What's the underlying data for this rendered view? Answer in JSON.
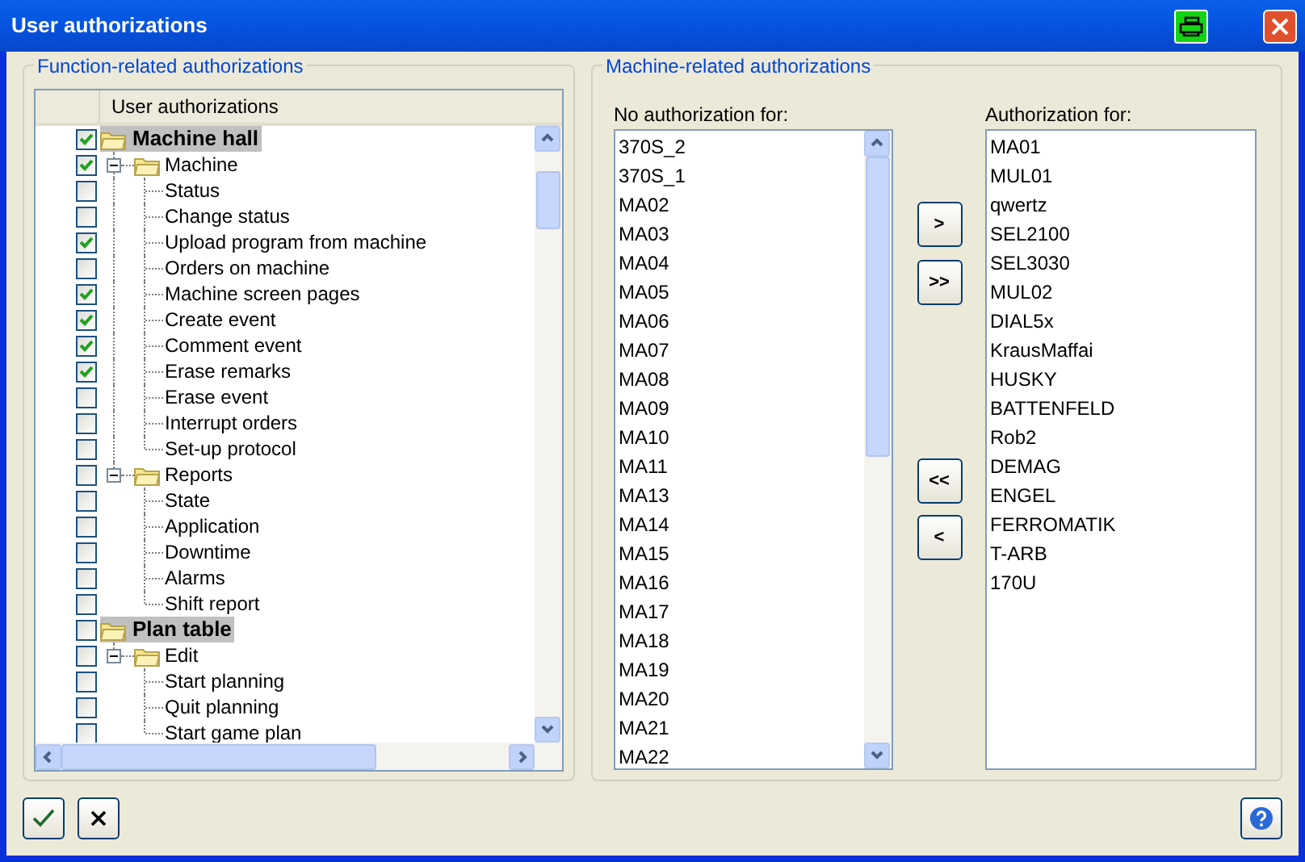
{
  "window": {
    "title": "User authorizations"
  },
  "function_group": {
    "title": "Function-related authorizations",
    "column_header": "User authorizations",
    "tree": [
      {
        "label": "Machine hall",
        "checked": true,
        "kind": "root",
        "children": [
          {
            "label": "Machine",
            "checked": true,
            "kind": "folder",
            "expanded": true,
            "children": [
              {
                "label": "Status",
                "checked": false,
                "kind": "leaf"
              },
              {
                "label": "Change status",
                "checked": false,
                "kind": "leaf"
              },
              {
                "label": "Upload program from machine",
                "checked": true,
                "kind": "leaf"
              },
              {
                "label": "Orders on machine",
                "checked": false,
                "kind": "leaf"
              },
              {
                "label": "Machine screen pages",
                "checked": true,
                "kind": "leaf"
              },
              {
                "label": "Create event",
                "checked": true,
                "kind": "leaf"
              },
              {
                "label": "Comment event",
                "checked": true,
                "kind": "leaf"
              },
              {
                "label": "Erase remarks",
                "checked": true,
                "kind": "leaf"
              },
              {
                "label": "Erase event",
                "checked": false,
                "kind": "leaf"
              },
              {
                "label": "Interrupt orders",
                "checked": false,
                "kind": "leaf"
              },
              {
                "label": "Set-up protocol",
                "checked": false,
                "kind": "leaf"
              }
            ]
          },
          {
            "label": "Reports",
            "checked": false,
            "kind": "folder",
            "expanded": true,
            "children": [
              {
                "label": "State",
                "checked": false,
                "kind": "leaf"
              },
              {
                "label": "Application",
                "checked": false,
                "kind": "leaf"
              },
              {
                "label": "Downtime",
                "checked": false,
                "kind": "leaf"
              },
              {
                "label": "Alarms",
                "checked": false,
                "kind": "leaf"
              },
              {
                "label": "Shift report",
                "checked": false,
                "kind": "leaf"
              }
            ]
          }
        ]
      },
      {
        "label": "Plan table",
        "checked": false,
        "kind": "root",
        "children": [
          {
            "label": "Edit",
            "checked": false,
            "kind": "folder",
            "expanded": true,
            "children": [
              {
                "label": "Start planning",
                "checked": false,
                "kind": "leaf"
              },
              {
                "label": "Quit planning",
                "checked": false,
                "kind": "leaf"
              },
              {
                "label": "Start game plan",
                "checked": false,
                "kind": "leaf"
              }
            ]
          }
        ]
      }
    ]
  },
  "machine_group": {
    "title": "Machine-related authorizations",
    "unauthorized": {
      "label": "No authorization for:",
      "items": [
        "370S_2",
        "370S_1",
        "MA02",
        "MA03",
        "MA04",
        "MA05",
        "MA06",
        "MA07",
        "MA08",
        "MA09",
        "MA10",
        "MA11",
        "MA13",
        "MA14",
        "MA15",
        "MA16",
        "MA17",
        "MA18",
        "MA19",
        "MA20",
        "MA21",
        "MA22"
      ]
    },
    "transfer_buttons": [
      ">",
      ">>",
      "<<",
      "<"
    ],
    "authorized": {
      "label": "Authorization for:",
      "items": [
        "MA01",
        "MUL01",
        "qwertz",
        "SEL2100",
        "SEL3030",
        "MUL02",
        "DIAL5x",
        "KrausMaffai",
        "HUSKY",
        "BATTENFELD",
        "Rob2",
        "DEMAG",
        "ENGEL",
        "FERROMATIK",
        "T-ARB",
        "170U"
      ]
    }
  }
}
